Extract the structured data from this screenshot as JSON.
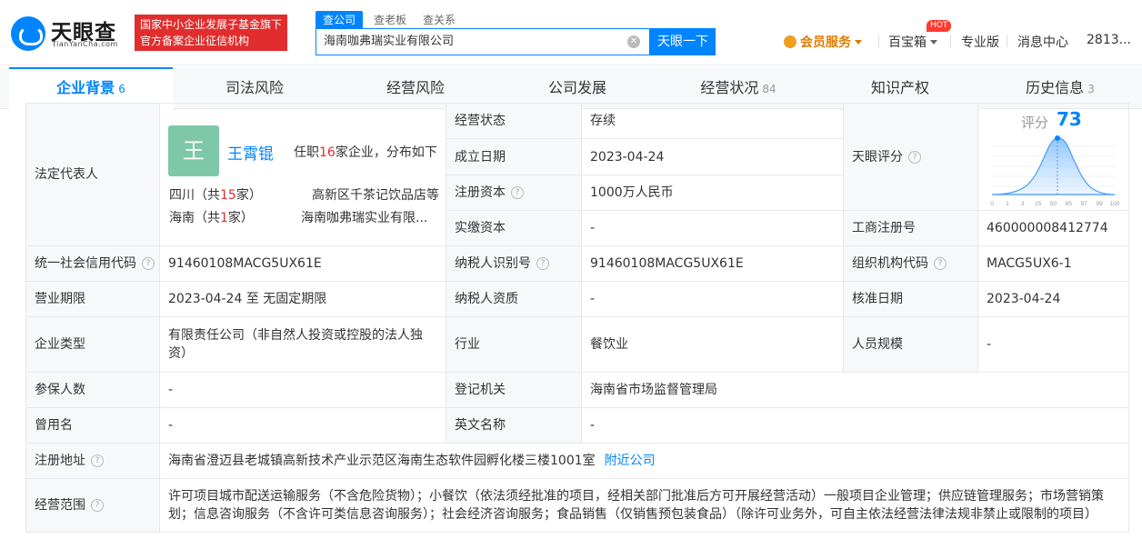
{
  "header": {
    "logo_text": "天眼查",
    "logo_sub": "TianYanCha.com",
    "gov_badge_line1": "国家中小企业发展子基金旗下",
    "gov_badge_line2": "官方备案企业征信机构",
    "search_tabs": [
      "查公司",
      "查老板",
      "查关系"
    ],
    "search_value": "海南咖弗瑞实业有限公司",
    "search_button": "天眼一下",
    "vip": "会员服务",
    "treasure": "百宝箱",
    "hot": "HOT",
    "pro": "专业版",
    "messages": "消息中心",
    "user": "2813..."
  },
  "tabs": [
    {
      "label": "企业背景",
      "count": "6"
    },
    {
      "label": "司法风险",
      "count": ""
    },
    {
      "label": "经营风险",
      "count": ""
    },
    {
      "label": "公司发展",
      "count": ""
    },
    {
      "label": "经营状况",
      "count": "84"
    },
    {
      "label": "知识产权",
      "count": ""
    },
    {
      "label": "历史信息",
      "count": "3"
    }
  ],
  "info": {
    "legal_rep_label": "法定代表人",
    "avatar_char": "王",
    "legal_rep_name": "王霄锟",
    "tenure_prefix": "任职",
    "tenure_count": "16",
    "tenure_suffix": "家企业，分布如下",
    "region1": "四川（共",
    "region1_count": "15",
    "region1_unit": "家）",
    "region1_company": "高新区千茶记饮品店等",
    "region2": "海南（共",
    "region2_count": "1",
    "region2_unit": "家）",
    "region2_company": "海南咖弗瑞实业有限...",
    "status_label": "经营状态",
    "status_value": "存续",
    "founded_label": "成立日期",
    "founded_value": "2023-04-24",
    "reg_capital_label": "注册资本",
    "reg_capital_value": "1000万人民币",
    "paid_capital_label": "实缴资本",
    "paid_capital_value": "-",
    "score_label": "天眼评分",
    "score_title": "评分",
    "score_value": "73",
    "biz_reg_label": "工商注册号",
    "biz_reg_value": "460000008412774",
    "credit_code_label": "统一社会信用代码",
    "credit_code_value": "91460108MACG5UX61E",
    "taxpayer_id_label": "纳税人识别号",
    "taxpayer_id_value": "91460108MACG5UX61E",
    "org_code_label": "组织机构代码",
    "org_code_value": "MACG5UX6-1",
    "term_label": "营业期限",
    "term_value": "2023-04-24 至 无固定期限",
    "taxpayer_qual_label": "纳税人资质",
    "taxpayer_qual_value": "-",
    "approval_label": "核准日期",
    "approval_value": "2023-04-24",
    "type_label": "企业类型",
    "type_value": "有限责任公司（非自然人投资或控股的法人独资）",
    "industry_label": "行业",
    "industry_value": "餐饮业",
    "staff_label": "人员规模",
    "staff_value": "-",
    "insured_label": "参保人数",
    "insured_value": "-",
    "authority_label": "登记机关",
    "authority_value": "海南省市场监督管理局",
    "former_label": "曾用名",
    "former_value": "-",
    "english_label": "英文名称",
    "english_value": "-",
    "address_label": "注册地址",
    "address_value": "海南省澄迈县老城镇高新技术产业示范区海南生态软件园孵化楼三楼1001室",
    "nearby_link": "附近公司",
    "scope_label": "经营范围",
    "scope_value": "许可项目城市配送运输服务（不含危险货物）；小餐饮（依法须经批准的项目，经相关部门批准后方可开展经营活动）一般项目企业管理；供应链管理服务；市场营销策划；信息咨询服务（不含许可类信息咨询服务）；社会经济咨询服务；食品销售（仅销售预包装食品）（除许可业务外，可自主依法经营法律法规非禁止或限制的项目）"
  },
  "score_chart_ticks": [
    "0",
    "1",
    "3",
    "15",
    "50",
    "85",
    "97",
    "99",
    "100"
  ],
  "colors": {
    "accent": "#0084ff",
    "badge": "#e12d2d",
    "vip": "#e07b00"
  }
}
